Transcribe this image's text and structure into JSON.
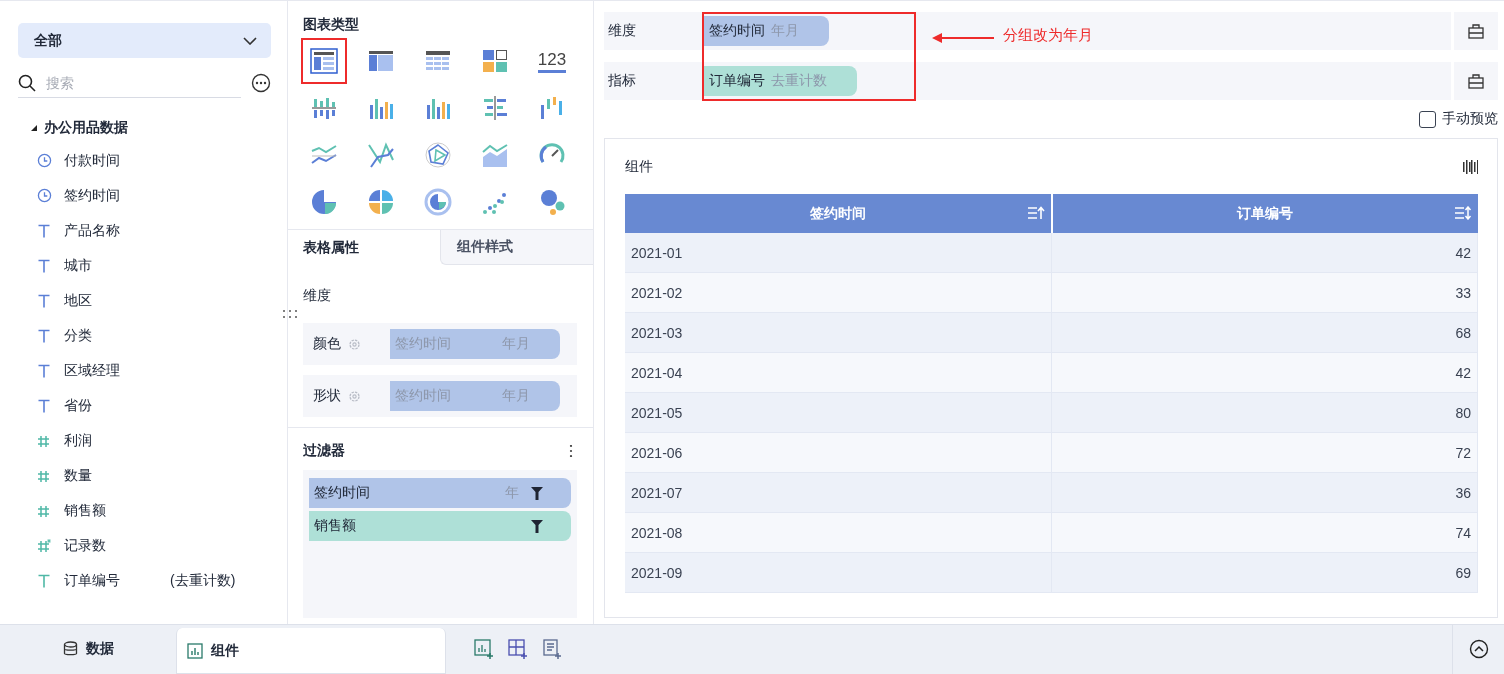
{
  "left_panel": {
    "dropdown": {
      "value": "全部"
    },
    "search": {
      "placeholder": "搜索"
    },
    "dataset": {
      "name": "办公用品数据",
      "expanded": true,
      "fields": [
        {
          "label": "付款时间",
          "kind": "time"
        },
        {
          "label": "签约时间",
          "kind": "time"
        },
        {
          "label": "产品名称",
          "kind": "text"
        },
        {
          "label": "城市",
          "kind": "text"
        },
        {
          "label": "地区",
          "kind": "text"
        },
        {
          "label": "分类",
          "kind": "text"
        },
        {
          "label": "区域经理",
          "kind": "text"
        },
        {
          "label": "省份",
          "kind": "text"
        },
        {
          "label": "利润",
          "kind": "number"
        },
        {
          "label": "数量",
          "kind": "number"
        },
        {
          "label": "销售额",
          "kind": "number"
        },
        {
          "label": "记录数",
          "kind": "count"
        },
        {
          "label": "订单编号",
          "kind": "measure_text",
          "note": "(去重计数)"
        }
      ]
    }
  },
  "chart_types": {
    "title": "图表类型",
    "items": [
      {
        "kind": "table",
        "selected": true
      },
      {
        "kind": "cross_table",
        "selected": false
      },
      {
        "kind": "detail_table",
        "selected": false
      },
      {
        "kind": "blocks",
        "selected": false
      },
      {
        "kind": "kpi",
        "label": "123",
        "selected": false
      },
      {
        "kind": "bar_a",
        "selected": false
      },
      {
        "kind": "bar_b",
        "selected": false
      },
      {
        "kind": "bar_c",
        "selected": false
      },
      {
        "kind": "bar_h",
        "selected": false
      },
      {
        "kind": "bar_d",
        "selected": false
      },
      {
        "kind": "line_a",
        "selected": false
      },
      {
        "kind": "line_b",
        "selected": false
      },
      {
        "kind": "radar",
        "selected": false
      },
      {
        "kind": "area",
        "selected": false
      },
      {
        "kind": "gauge",
        "selected": false
      },
      {
        "kind": "pie",
        "selected": false
      },
      {
        "kind": "pie_b",
        "selected": false
      },
      {
        "kind": "ring",
        "selected": false
      },
      {
        "kind": "scatter",
        "selected": false
      },
      {
        "kind": "bubble",
        "selected": false
      }
    ]
  },
  "property_tabs": [
    {
      "label": "表格属性",
      "selected": true
    },
    {
      "label": "组件样式",
      "selected": false
    }
  ],
  "properties": {
    "section": "维度",
    "rows": [
      {
        "label": "颜色",
        "field": "签约时间",
        "group": "年月",
        "disabled": true
      },
      {
        "label": "形状",
        "field": "签约时间",
        "group": "年月",
        "disabled": true
      }
    ]
  },
  "filter": {
    "title": "过滤器",
    "items": [
      {
        "field": "签约时间",
        "group": "年",
        "kind": "dimension"
      },
      {
        "field": "销售额",
        "kind": "measure"
      }
    ]
  },
  "shelves": [
    {
      "label": "维度",
      "field": "签约时间",
      "group": "年月",
      "kind": "dimension"
    },
    {
      "label": "指标",
      "field": "订单编号",
      "group": "去重计数",
      "kind": "measure"
    }
  ],
  "annotation": {
    "text": "分组改为年月"
  },
  "manual_preview": {
    "label": "手动预览",
    "checked": false
  },
  "component": {
    "title": "组件",
    "table": {
      "columns": [
        "签约时间",
        "订单编号"
      ],
      "rows": [
        [
          "2021-01",
          "42"
        ],
        [
          "2021-02",
          "33"
        ],
        [
          "2021-03",
          "68"
        ],
        [
          "2021-04",
          "42"
        ],
        [
          "2021-05",
          "80"
        ],
        [
          "2021-06",
          "72"
        ],
        [
          "2021-07",
          "36"
        ],
        [
          "2021-08",
          "74"
        ],
        [
          "2021-09",
          "69"
        ]
      ]
    }
  },
  "bottom_tabs": [
    {
      "label": "数据",
      "kind": "data",
      "selected": false
    },
    {
      "label": "组件",
      "kind": "component",
      "selected": true
    }
  ]
}
